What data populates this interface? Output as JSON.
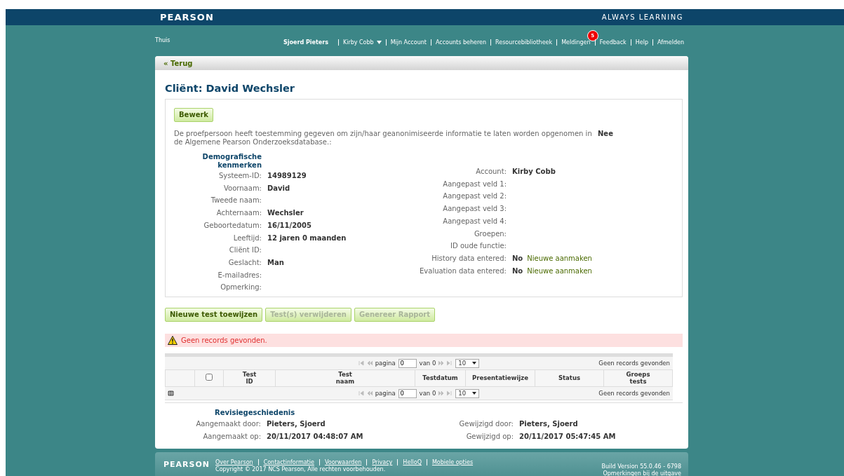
{
  "header": {
    "logo": "PEARSON",
    "tagline": "ALWAYS LEARNING"
  },
  "nav": {
    "home": "Thuis",
    "items": [
      {
        "label": "Sjoerd Pieters",
        "kind": "user"
      },
      {
        "label": "Kirby Cobb",
        "kind": "dropdown"
      },
      {
        "label": "Mijn Account",
        "kind": "link"
      },
      {
        "label": "Accounts beheren",
        "kind": "link"
      },
      {
        "label": "Resourcebibliotheek",
        "kind": "link"
      },
      {
        "label": "Meldingen",
        "kind": "link",
        "badge": "5"
      },
      {
        "label": "Feedback",
        "kind": "link"
      },
      {
        "label": "Help",
        "kind": "link"
      },
      {
        "label": "Afmelden",
        "kind": "link"
      }
    ]
  },
  "back_link": "« Terug",
  "title": "Cliënt: David Wechsler",
  "edit_button": "Bewerk",
  "consent": {
    "text": "De proefpersoon heeft toestemming gegeven om zijn/haar geanonimiseerde informatie te laten worden opgenomen in de Algemene Pearson Onderzoeksdatabase.:",
    "value": "Nee"
  },
  "demographics": {
    "heading": "Demografische kenmerken",
    "fields": [
      {
        "label": "Systeem-ID:",
        "value": "14989129"
      },
      {
        "label": "Voornaam:",
        "value": "David"
      },
      {
        "label": "Tweede naam:"
      },
      {
        "label": "Achternaam:",
        "value": "Wechsler"
      },
      {
        "label": "Geboortedatum:",
        "value": "16/11/2005"
      },
      {
        "label": "Leeftijd:",
        "value": "12 jaren 0 maanden"
      },
      {
        "label": "Cliënt ID:"
      },
      {
        "label": "Geslacht:",
        "value": "Man"
      },
      {
        "label": "E-mailadres:"
      },
      {
        "label": "Opmerking:"
      }
    ]
  },
  "account_fields": [
    {
      "label": "Account:",
      "value": "Kirby Cobb"
    },
    {
      "label": "Aangepast veld 1:"
    },
    {
      "label": "Aangepast veld 2:"
    },
    {
      "label": "Aangepast veld 3:"
    },
    {
      "label": "Aangepast veld 4:"
    },
    {
      "label": "Groepen:"
    },
    {
      "label": "ID oude functie:"
    },
    {
      "label": "History data entered:",
      "value": "No",
      "link": "Nieuwe aanmaken"
    },
    {
      "label": "Evaluation data entered:",
      "value": "No",
      "link": "Nieuwe aanmaken"
    }
  ],
  "actions": [
    {
      "label": "Nieuwe test toewijzen",
      "disabled": false
    },
    {
      "label": "Test(s) verwijderen",
      "disabled": true
    },
    {
      "label": "Genereer Rapport",
      "disabled": true
    }
  ],
  "alert": "Geen records gevonden.",
  "grid": {
    "pager_top": {
      "page_label": "pagina",
      "page_value": "0",
      "of_label": "van 0",
      "page_size": "10",
      "status": "Geen records gevonden"
    },
    "header_checkbox": {
      "checked": false
    },
    "columns": [
      "Test\nID",
      "Test\nnaam",
      "Testdatum",
      "Presentatiewijze",
      "Status",
      "Groeps\ntests"
    ],
    "pager_bottom": {
      "page_label": "pagina",
      "page_value": "0",
      "of_label": "van 0",
      "page_size": "10",
      "status": "Geen records gevonden"
    }
  },
  "revision": {
    "heading": "Revisiegeschiedenis",
    "left": [
      {
        "label": "Aangemaakt door:",
        "value": "Pieters, Sjoerd"
      },
      {
        "label": "Aangemaakt op:",
        "value": "20/11/2017 04:48:07 AM"
      }
    ],
    "right": [
      {
        "label": "Gewijzigd door:",
        "value": "Pieters, Sjoerd"
      },
      {
        "label": "Gewijzigd op:",
        "value": "20/11/2017 05:47:45 AM"
      }
    ]
  },
  "footer": {
    "logo": "PEARSON",
    "links": [
      "Over Pearson",
      "Contactinformatie",
      "Voorwaarden",
      "Privacy",
      "HelloQ",
      "Mobiele opties"
    ],
    "copyright": "Copyright © 2017 NCS Pearson, Alle rechten voorbehouden.",
    "build": "Build Version 55.0.46 - 6798",
    "release_notes": "Opmerkingen bij de uitgave"
  }
}
